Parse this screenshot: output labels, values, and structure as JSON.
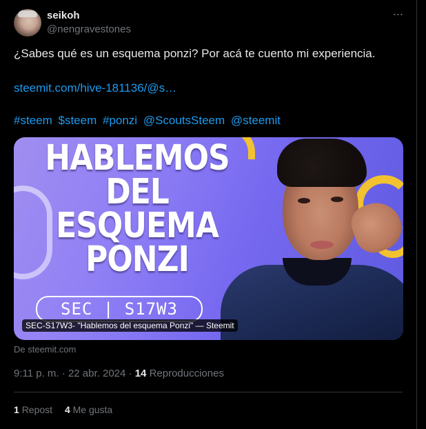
{
  "author": {
    "name": "seikoh",
    "handle": "@nengravestones"
  },
  "menu_icon": "more-horizontal-icon",
  "tweet": {
    "text": "¿Sabes qué es un esquema ponzi? Por acá te cuento mi experiencia.",
    "link": "steemit.com/hive-181136/@s…",
    "hashtags": [
      "#steem",
      "$steem",
      "#ponzi",
      " @ScoutsSteem",
      "@steemit"
    ]
  },
  "card": {
    "headline_lines": [
      "HABLEMOS",
      "DEL",
      "ESQUEMA",
      "PONZI"
    ],
    "pill_text": "SEC | S17W3",
    "caption": "SEC-S17W3- \"Hablemos del esquema Ponzi\" — Steemit"
  },
  "source": "De steemit.com",
  "meta": {
    "time": "9:11 p. m.",
    "separator": "·",
    "date": "22 abr. 2024",
    "views_count": "14",
    "views_label": "Reproducciones"
  },
  "stats": {
    "reposts_count": "1",
    "reposts_label": "Repost",
    "likes_count": "4",
    "likes_label": "Me gusta"
  },
  "colors": {
    "background": "#000000",
    "text": "#e7e9ea",
    "secondary": "#71767b",
    "link": "#1d9bf0",
    "card_purple": "#8f7ff5",
    "card_yellow": "#f2c230"
  }
}
